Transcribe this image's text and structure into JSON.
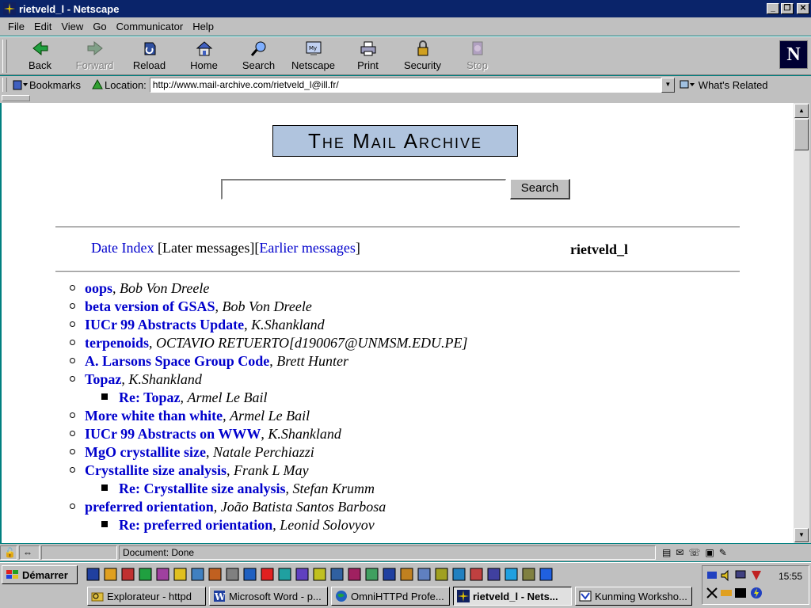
{
  "window": {
    "title": "rietveld_l - Netscape"
  },
  "menu": [
    "File",
    "Edit",
    "View",
    "Go",
    "Communicator",
    "Help"
  ],
  "toolbar": {
    "back": "Back",
    "forward": "Forward",
    "reload": "Reload",
    "home": "Home",
    "search": "Search",
    "netscape": "Netscape",
    "print": "Print",
    "security": "Security",
    "stop": "Stop"
  },
  "location": {
    "bookmarks": "Bookmarks",
    "label": "Location:",
    "url": "http://www.mail-archive.com/rietveld_l@ill.fr/",
    "related": "What's Related"
  },
  "page": {
    "logo": "The Mail Archive",
    "search_button": "Search",
    "search_value": "",
    "nav": {
      "date_index": "Date Index",
      "later": "[Later messages]",
      "earlier_open": "[",
      "earlier": "Earlier messages",
      "earlier_close": "]"
    },
    "list_name": "rietveld_l",
    "threads": [
      {
        "subject": "oops",
        "author": "Bob Von Dreele",
        "reply": false
      },
      {
        "subject": "beta version of GSAS",
        "author": "Bob Von Dreele",
        "reply": false
      },
      {
        "subject": "IUCr 99 Abstracts Update",
        "author": "K.Shankland",
        "reply": false
      },
      {
        "subject": "terpenoids",
        "author": "OCTAVIO RETUERTO[d190067@UNMSM.EDU.PE]",
        "reply": false
      },
      {
        "subject": "A. Larsons Space Group Code",
        "author": "Brett Hunter",
        "reply": false
      },
      {
        "subject": "Topaz",
        "author": "K.Shankland",
        "reply": false
      },
      {
        "subject": "Re: Topaz",
        "author": "Armel Le Bail",
        "reply": true
      },
      {
        "subject": "More white than white",
        "author": "Armel Le Bail",
        "reply": false
      },
      {
        "subject": "IUCr 99 Abstracts on WWW",
        "author": "K.Shankland",
        "reply": false
      },
      {
        "subject": "MgO crystallite size",
        "author": "Natale Perchiazzi",
        "reply": false
      },
      {
        "subject": "Crystallite size analysis",
        "author": "Frank L May",
        "reply": false
      },
      {
        "subject": "Re: Crystallite size analysis",
        "author": "Stefan Krumm",
        "reply": true
      },
      {
        "subject": "preferred orientation",
        "author": "João Batista Santos Barbosa",
        "reply": false
      },
      {
        "subject": "Re: preferred orientation",
        "author": "Leonid Solovyov",
        "reply": true
      }
    ]
  },
  "status": {
    "text": "Document: Done"
  },
  "taskbar": {
    "start": "Démarrer",
    "tasks": [
      {
        "label": "Explorateur - httpd",
        "active": false
      },
      {
        "label": "Microsoft Word - p...",
        "active": false
      },
      {
        "label": "OmniHTTPd Profe...",
        "active": false
      },
      {
        "label": "rietveld_l - Nets...",
        "active": true
      },
      {
        "label": "Kunming Worksho...",
        "active": false
      }
    ],
    "clock": "15:55"
  },
  "colors": {
    "titlebar": "#0a246a",
    "link": "#0000cc",
    "chrome": "#c0c0c0",
    "desktop": "#008080",
    "logo_bg": "#b0c4de"
  }
}
